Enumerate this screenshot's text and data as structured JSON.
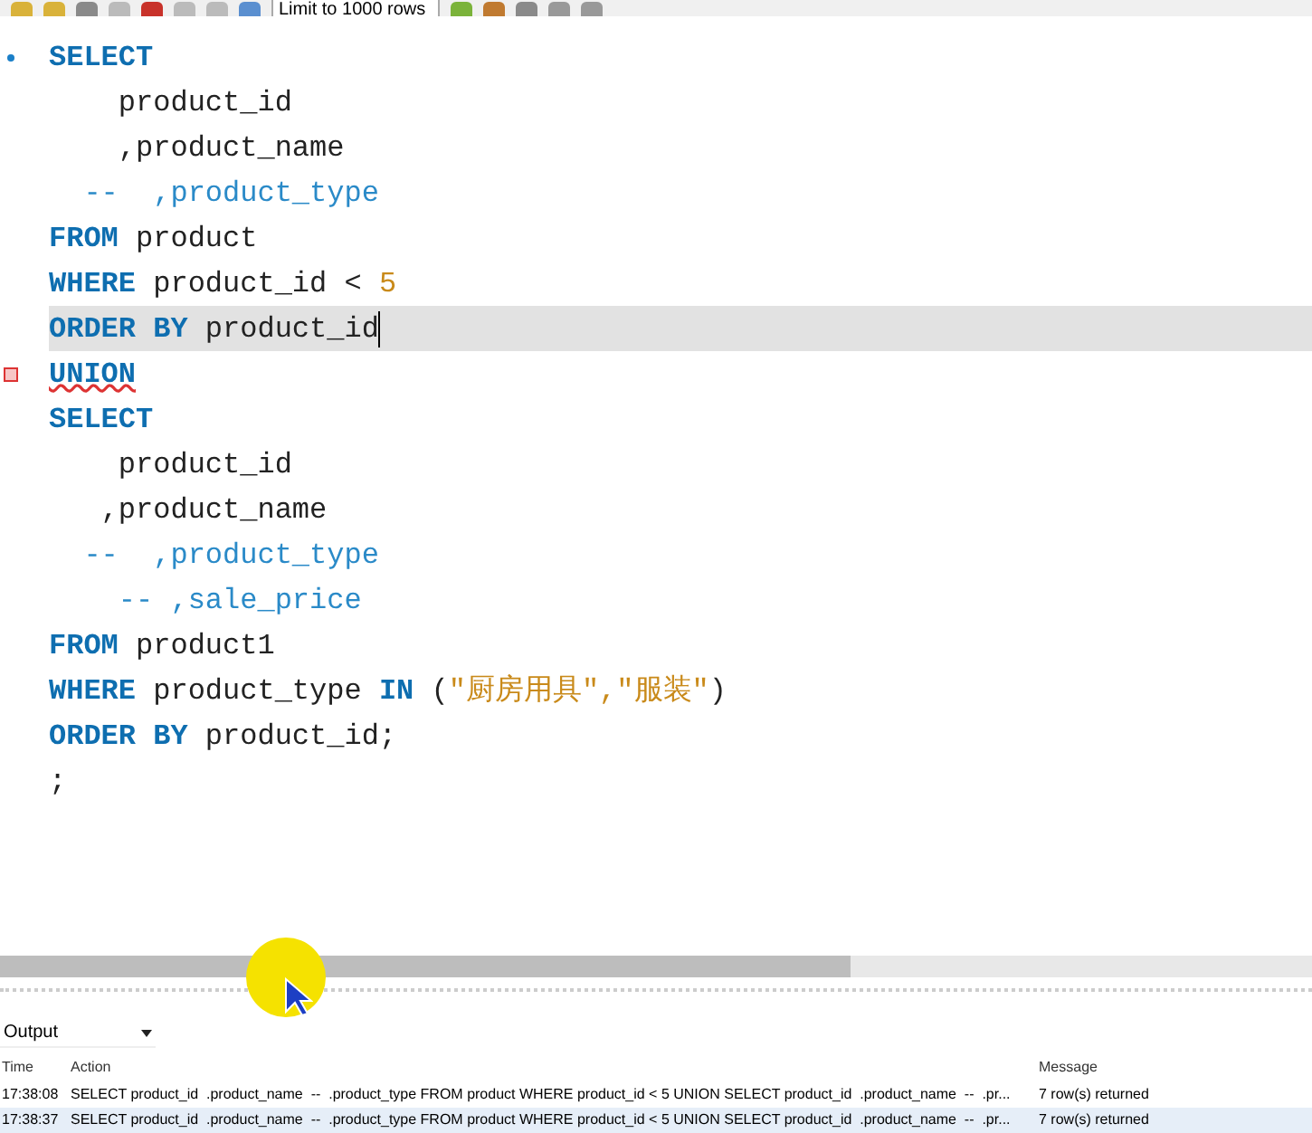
{
  "toolbar": {
    "limit_select": "Limit to 1000 rows"
  },
  "editor": {
    "lines": [
      {
        "statement_start": true,
        "error": false,
        "current": false,
        "tokens": [
          {
            "kind": "keyword",
            "text": "SELECT"
          }
        ]
      },
      {
        "statement_start": false,
        "error": false,
        "current": false,
        "tokens": [
          {
            "kind": "plain",
            "text": "    product_id"
          }
        ]
      },
      {
        "statement_start": false,
        "error": false,
        "current": false,
        "tokens": [
          {
            "kind": "plain",
            "text": "    ,product_name"
          }
        ]
      },
      {
        "statement_start": false,
        "error": false,
        "current": false,
        "tokens": [
          {
            "kind": "comment",
            "text": "  --  ,product_type"
          }
        ]
      },
      {
        "statement_start": false,
        "error": false,
        "current": false,
        "tokens": [
          {
            "kind": "keyword",
            "text": "FROM"
          },
          {
            "kind": "plain",
            "text": " product"
          }
        ]
      },
      {
        "statement_start": false,
        "error": false,
        "current": false,
        "tokens": [
          {
            "kind": "keyword",
            "text": "WHERE"
          },
          {
            "kind": "plain",
            "text": " product_id < "
          },
          {
            "kind": "number",
            "text": "5"
          }
        ]
      },
      {
        "statement_start": false,
        "error": false,
        "current": true,
        "tokens": [
          {
            "kind": "keyword",
            "text": "ORDER BY"
          },
          {
            "kind": "plain",
            "text": " product_id"
          }
        ]
      },
      {
        "statement_start": false,
        "error": true,
        "current": false,
        "tokens": [
          {
            "kind": "error",
            "text": "UNION"
          }
        ]
      },
      {
        "statement_start": false,
        "error": false,
        "current": false,
        "tokens": [
          {
            "kind": "keyword",
            "text": "SELECT"
          }
        ]
      },
      {
        "statement_start": false,
        "error": false,
        "current": false,
        "tokens": [
          {
            "kind": "plain",
            "text": "    product_id"
          }
        ]
      },
      {
        "statement_start": false,
        "error": false,
        "current": false,
        "tokens": [
          {
            "kind": "plain",
            "text": "   ,product_name"
          }
        ]
      },
      {
        "statement_start": false,
        "error": false,
        "current": false,
        "tokens": [
          {
            "kind": "comment",
            "text": "  --  ,product_type"
          }
        ]
      },
      {
        "statement_start": false,
        "error": false,
        "current": false,
        "tokens": [
          {
            "kind": "comment",
            "text": "    -- ,sale_price"
          }
        ]
      },
      {
        "statement_start": false,
        "error": false,
        "current": false,
        "tokens": [
          {
            "kind": "keyword",
            "text": "FROM"
          },
          {
            "kind": "plain",
            "text": " product1"
          }
        ]
      },
      {
        "statement_start": false,
        "error": false,
        "current": false,
        "tokens": [
          {
            "kind": "keyword",
            "text": "WHERE"
          },
          {
            "kind": "plain",
            "text": " product_type "
          },
          {
            "kind": "keyword",
            "text": "IN"
          },
          {
            "kind": "plain",
            "text": " ("
          },
          {
            "kind": "string",
            "text": "\"厨房用具\",\"服装\""
          },
          {
            "kind": "plain",
            "text": ")"
          }
        ]
      },
      {
        "statement_start": false,
        "error": false,
        "current": false,
        "tokens": [
          {
            "kind": "keyword",
            "text": "ORDER BY"
          },
          {
            "kind": "plain",
            "text": " product_id;"
          }
        ]
      },
      {
        "statement_start": false,
        "error": false,
        "current": false,
        "tokens": [
          {
            "kind": "plain",
            "text": ";"
          }
        ]
      }
    ]
  },
  "output": {
    "panel_select": "Output",
    "columns": [
      "Time",
      "Action",
      "Message"
    ],
    "rows": [
      {
        "time": "17:38:08",
        "action": "SELECT product_id  .product_name  --  .product_type FROM product WHERE product_id < 5 UNION SELECT product_id  .product_name  --  .pr...",
        "message": "7 row(s) returned",
        "selected": false
      },
      {
        "time": "17:38:37",
        "action": "SELECT product_id  .product_name  --  .product_type FROM product WHERE product_id < 5 UNION SELECT product_id  .product_name  --  .pr...",
        "message": "7 row(s) returned",
        "selected": true
      }
    ]
  }
}
